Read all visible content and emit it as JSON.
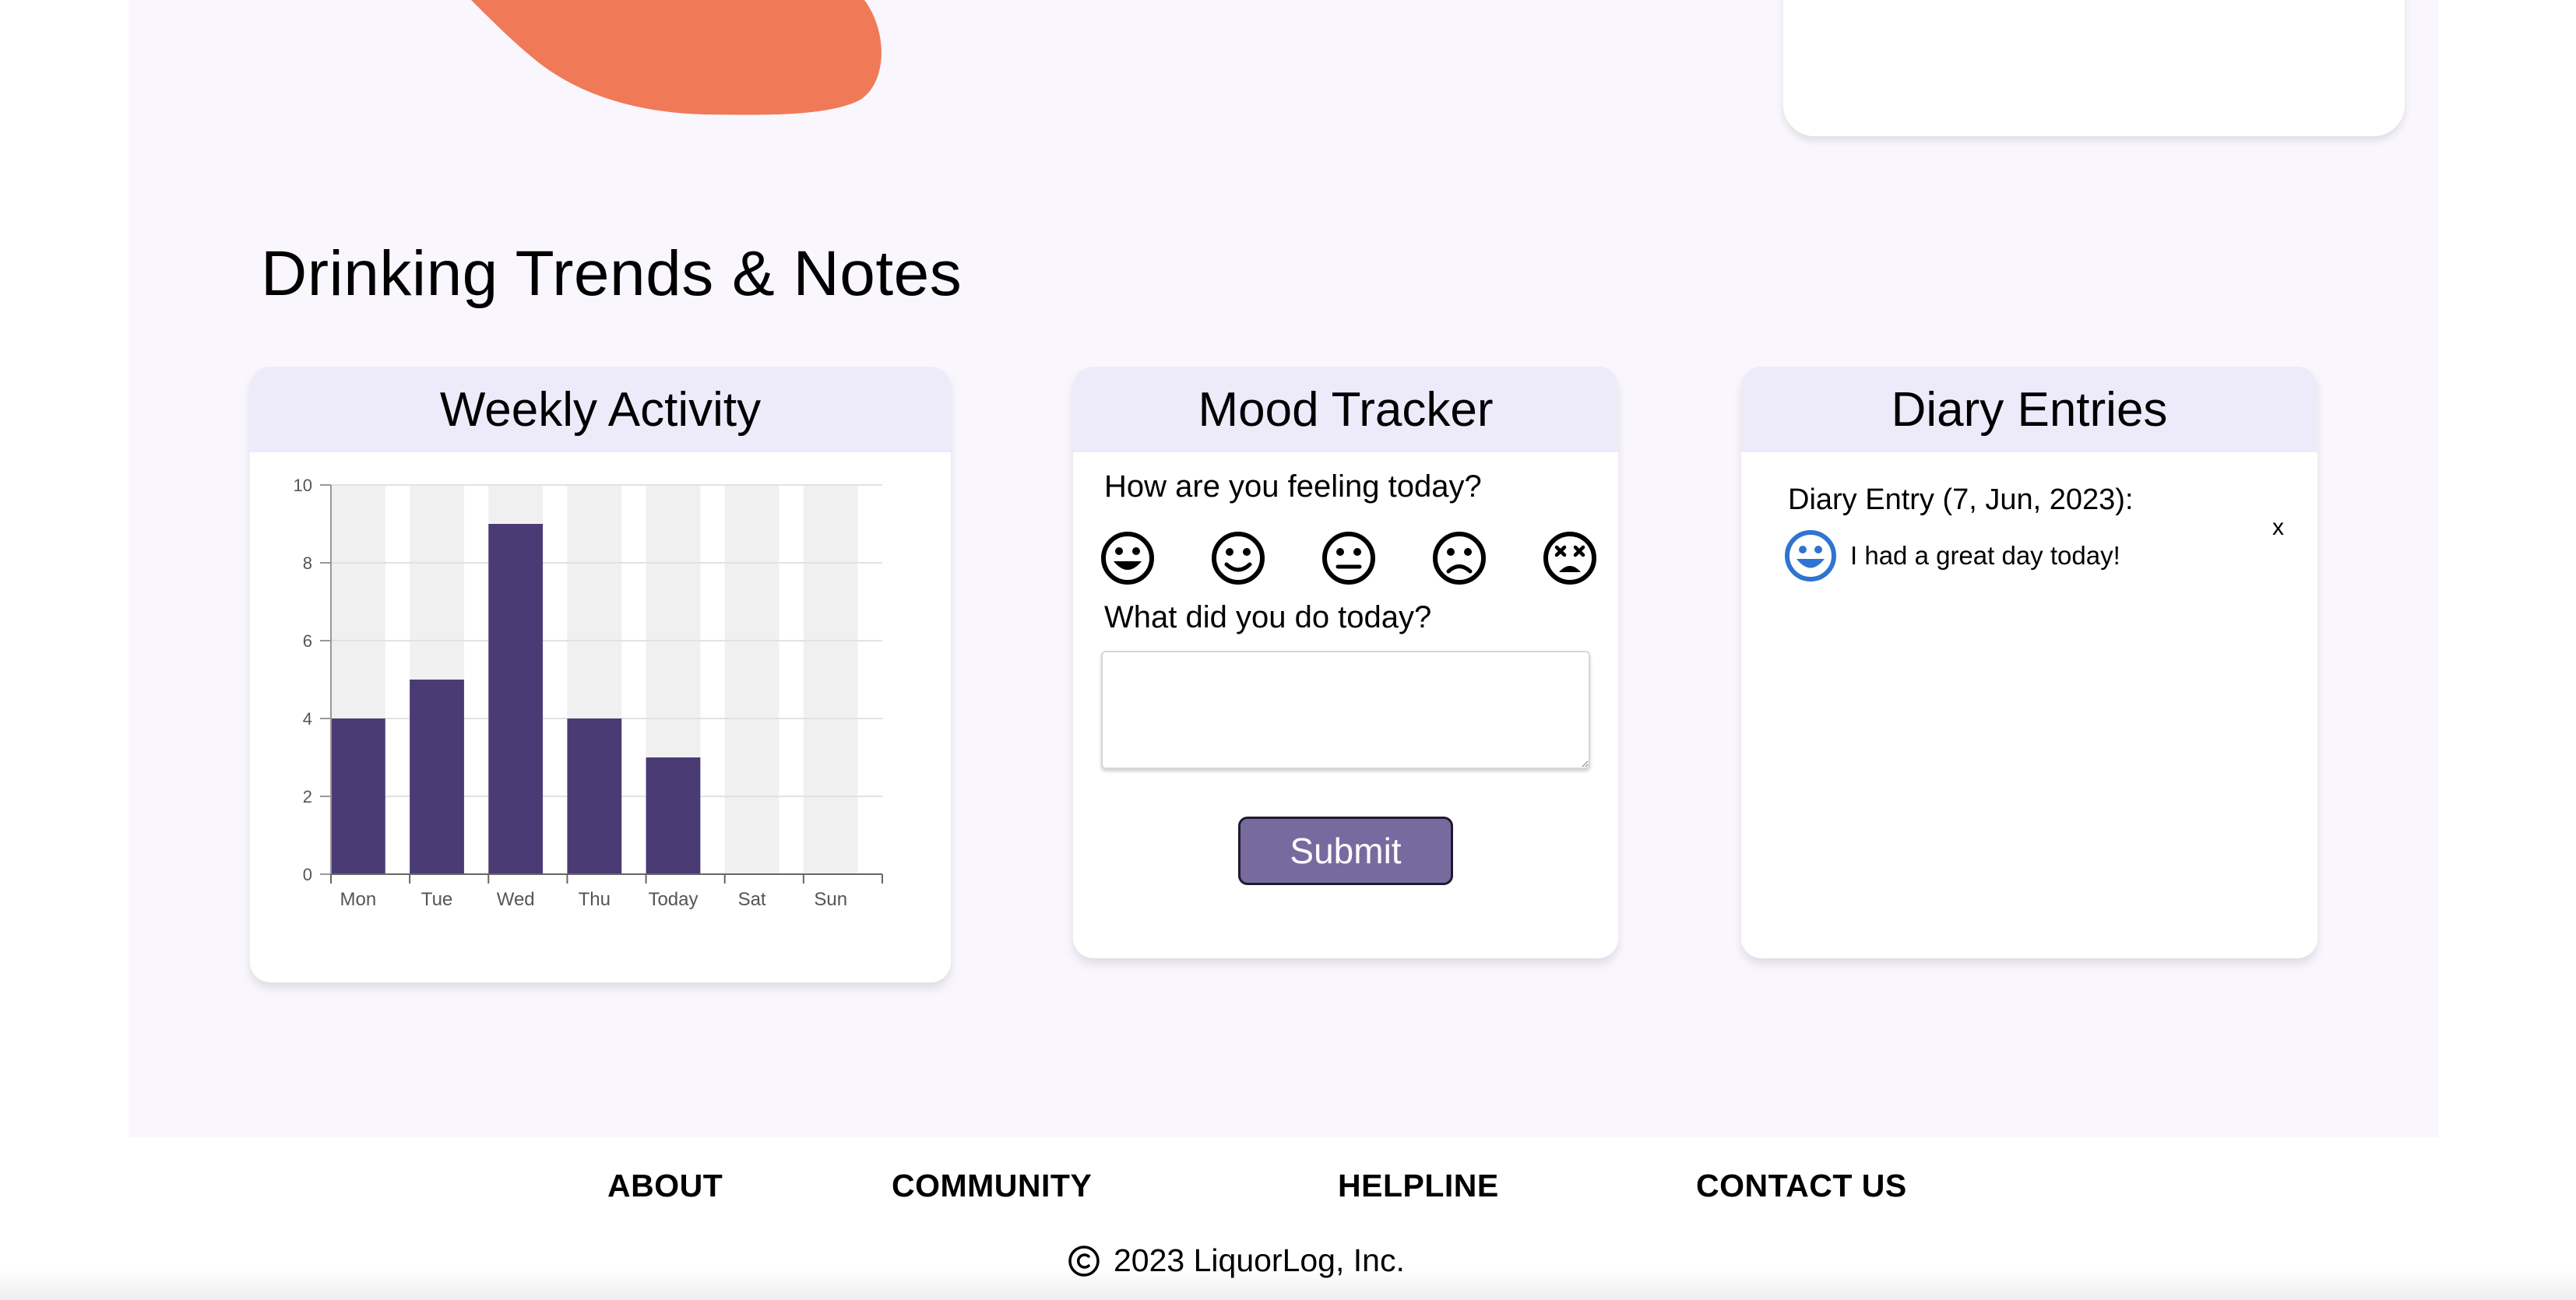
{
  "section": {
    "title": "Drinking Trends & Notes"
  },
  "weekly": {
    "title": "Weekly Activity"
  },
  "chart_data": {
    "type": "bar",
    "categories": [
      "Mon",
      "Tue",
      "Wed",
      "Thu",
      "Today",
      "Sat",
      "Sun"
    ],
    "values": [
      4,
      5,
      9,
      4,
      3,
      0,
      0
    ],
    "ylim": [
      0,
      10
    ],
    "yticks": [
      "0",
      "2",
      "4",
      "6",
      "8",
      "10"
    ],
    "grid": true,
    "bar_color": "#4b3b75",
    "track_color": "#f0f0f0"
  },
  "mood": {
    "title": "Mood Tracker",
    "question": "How are you feeling today?",
    "activity_question": "What did you do today?",
    "activity_value": "",
    "submit_label": "Submit",
    "faces": [
      "grinning-face-icon",
      "smiling-face-icon",
      "neutral-face-icon",
      "frowning-face-icon",
      "dizzy-face-icon"
    ]
  },
  "diary": {
    "title": "Diary Entries",
    "entries": [
      {
        "date": "Diary Entry (7, Jun, 2023):",
        "text": "I had a great day today!",
        "close": "x",
        "face_color": "#2f74d0"
      }
    ]
  },
  "footer": {
    "links": [
      "ABOUT",
      "COMMUNITY",
      "HELPLINE",
      "CONTACT US"
    ],
    "copyright": "2023 LiquorLog, Inc."
  },
  "colors": {
    "accent_orange": "#f07a58",
    "panel_bg": "#f9f7fd",
    "header_bg": "#edeafa",
    "button_bg": "#766a9e"
  }
}
